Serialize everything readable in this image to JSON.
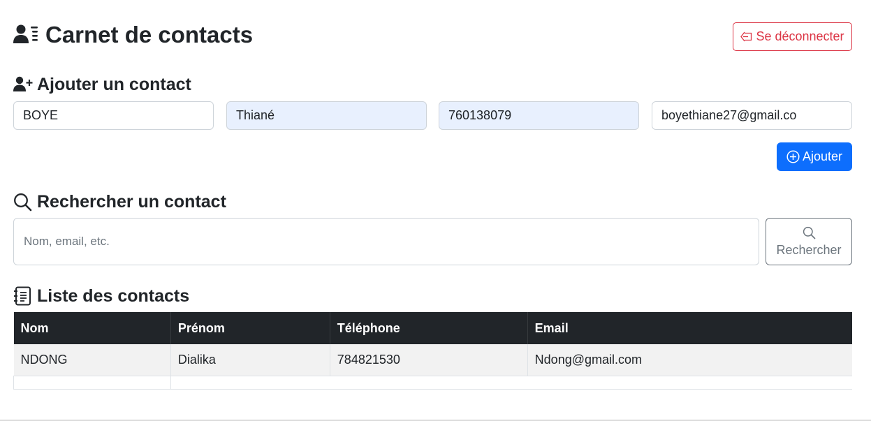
{
  "header": {
    "title": "Carnet de contacts",
    "logout_label": "Se déconnecter",
    "logout_icon": "door-arrow-left-icon"
  },
  "add_contact": {
    "title": "Ajouter un contact",
    "icon": "person-plus-icon",
    "fields": {
      "nom": "BOYE",
      "prenom": "Thiané",
      "telephone": "760138079",
      "email": "boyethiane27@gmail.co"
    },
    "submit_label": "Ajouter",
    "submit_icon": "plus-circle-icon"
  },
  "search": {
    "title": "Rechercher un contact",
    "icon": "search-icon",
    "placeholder": "Nom, email, etc.",
    "button_label": "Rechercher"
  },
  "contacts_list": {
    "title": "Liste des contacts",
    "icon": "journal-text-icon",
    "columns": [
      "Nom",
      "Prénom",
      "Téléphone",
      "Email"
    ],
    "rows": [
      [
        "NDONG",
        "Dialika",
        "784821530",
        "Ndong@gmail.com"
      ]
    ]
  },
  "colors": {
    "primary": "#0d6efd",
    "danger": "#dc3545",
    "table_header": "#212529",
    "autofill": "#e8f0fe"
  }
}
